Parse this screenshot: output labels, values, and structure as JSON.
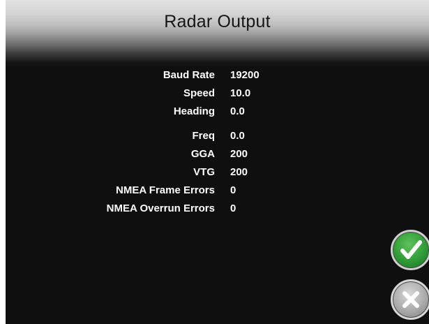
{
  "header": {
    "title": "Radar Output"
  },
  "readouts": [
    {
      "label": "Baud Rate",
      "value": "19200"
    },
    {
      "label": "Speed",
      "value": "10.0"
    },
    {
      "label": "Heading",
      "value": "0.0"
    },
    {
      "label": "Freq",
      "value": "0.0"
    },
    {
      "label": "GGA",
      "value": "200"
    },
    {
      "label": "VTG",
      "value": "200"
    },
    {
      "label": "NMEA Frame Errors",
      "value": "0"
    },
    {
      "label": "NMEA Overrun Errors",
      "value": "0"
    }
  ],
  "buttons": {
    "accept_icon": "checkmark-icon",
    "cancel_icon": "x-icon"
  },
  "colors": {
    "background": "#0f0f0f",
    "text": "#ffffff",
    "accept": "#2e9a36",
    "cancel": "#a9a9a9"
  }
}
